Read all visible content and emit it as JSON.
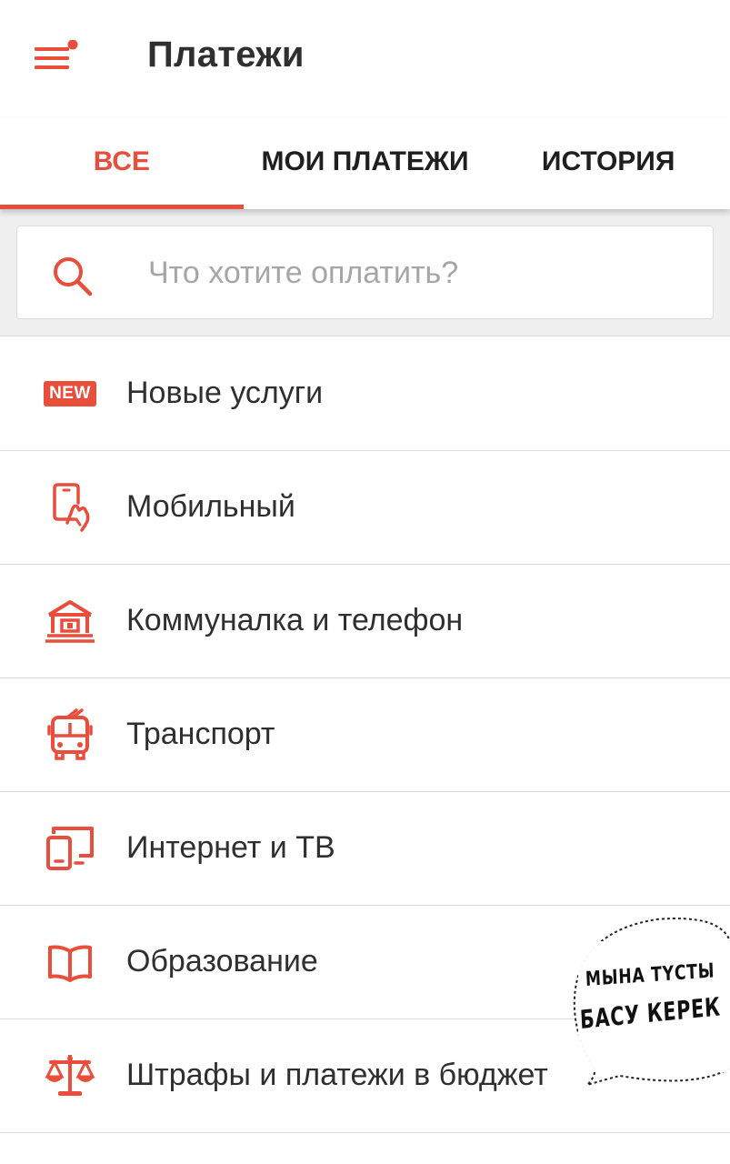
{
  "app_bar": {
    "title": "Платежи",
    "menu_icon": "menu-with-notification-dot-icon"
  },
  "tabs": [
    {
      "label": "ВСЕ",
      "active": true
    },
    {
      "label": "МОИ ПЛАТЕЖИ",
      "active": false
    },
    {
      "label": "ИСТОРИЯ",
      "active": false
    }
  ],
  "search": {
    "placeholder": "Что хотите оплатить?",
    "value": "",
    "icon": "search-icon"
  },
  "categories": [
    {
      "label": "Новые услуги",
      "icon": "new-badge",
      "badge": "NEW"
    },
    {
      "label": "Мобильный",
      "icon": "mobile-phone-touch-icon"
    },
    {
      "label": "Коммуналка и телефон",
      "icon": "house-icon"
    },
    {
      "label": "Транспорт",
      "icon": "trolleybus-icon"
    },
    {
      "label": "Интернет и ТВ",
      "icon": "devices-icon"
    },
    {
      "label": "Образование",
      "icon": "book-icon"
    },
    {
      "label": "Штрафы и платежи в бюджет",
      "icon": "scales-icon"
    }
  ],
  "sticker": {
    "line1": "МЫНА ТҮСТЫ",
    "line2": "БАСУ КЕРЕК"
  },
  "colors": {
    "accent": "#e94e3c",
    "text": "#2f2f2f",
    "placeholder": "#a6a6a6",
    "divider": "#dcdcdc",
    "search_bg": "#f0f0f0"
  }
}
